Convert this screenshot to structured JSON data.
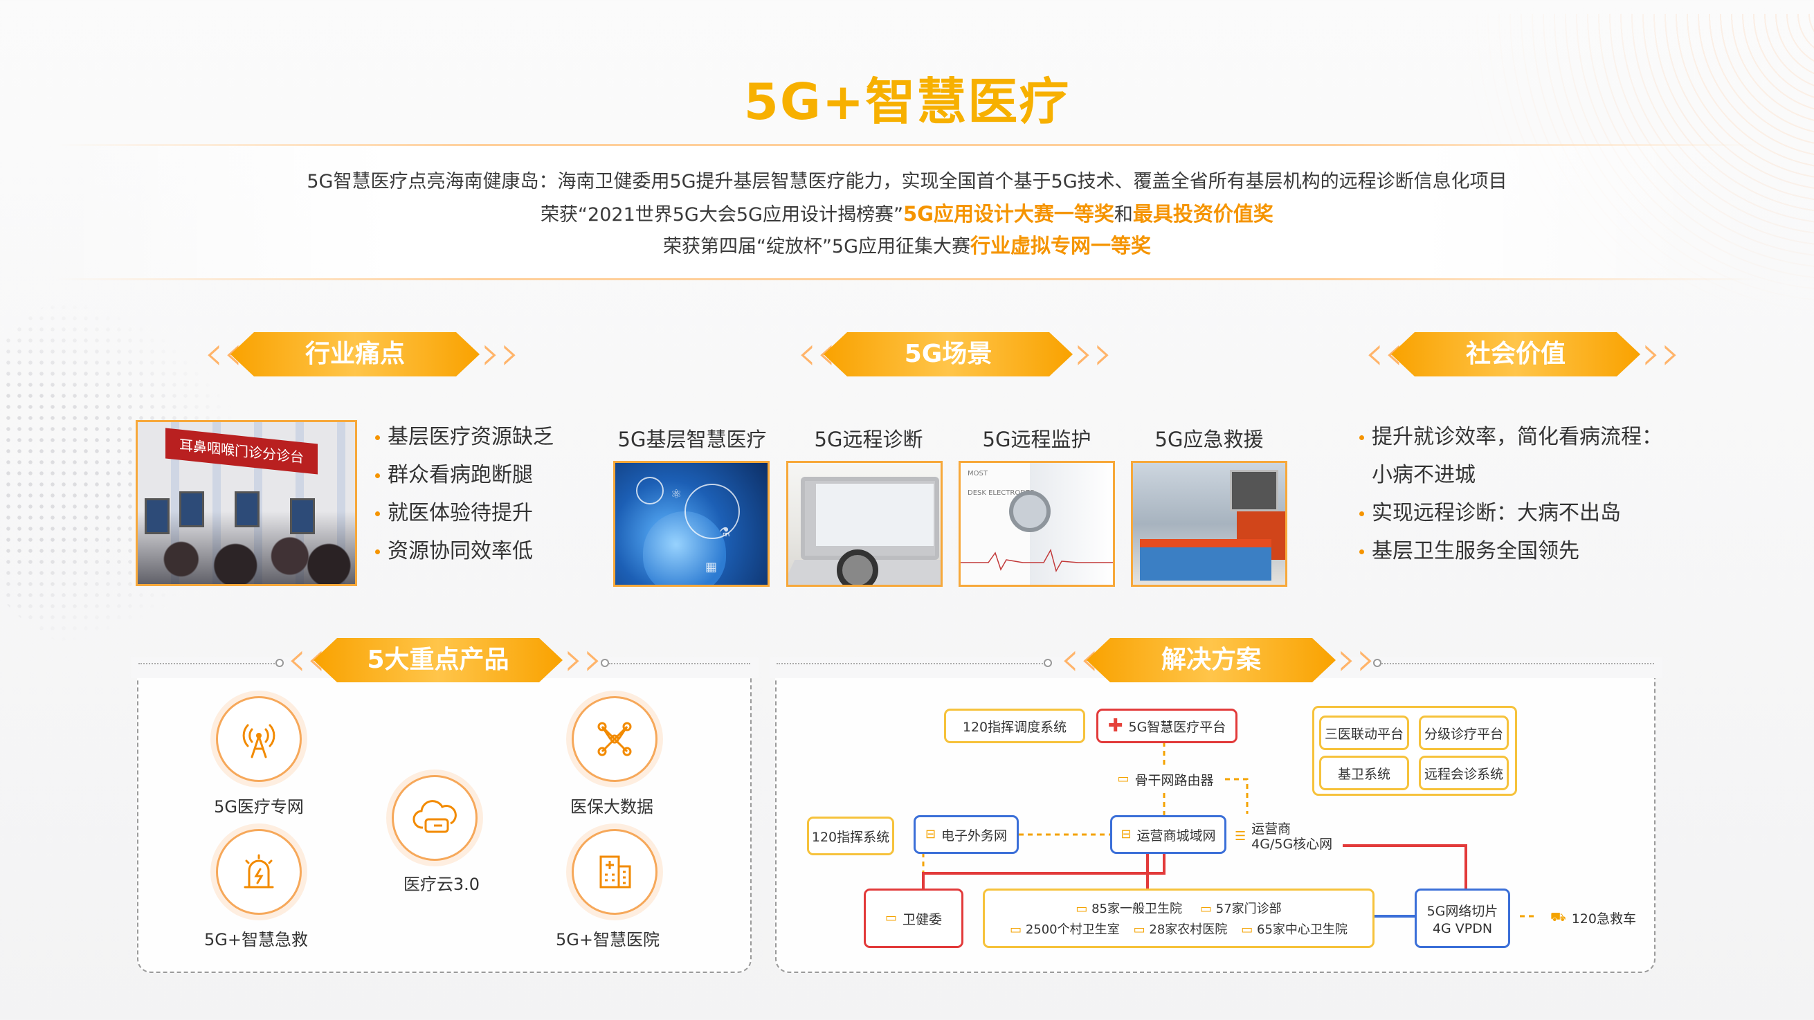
{
  "title": "5G+智慧医疗",
  "intro": {
    "line1": "5G智慧医疗点亮海南健康岛：海南卫健委用5G提升基层智慧医疗能力，实现全国首个基于5G技术、覆盖全省所有基层机构的远程诊断信息化项目",
    "line2_pre": "荣获“2021世界5G大会5G应用设计揭榜赛”",
    "line2_hl1": "5G应用设计大赛一等奖",
    "line2_mid": "和",
    "line2_hl2": "最具投资价值奖",
    "line3_pre": "荣获第四届“绽放杯”5G应用征集大赛",
    "line3_hl": "行业虚拟专网一等奖"
  },
  "sections": {
    "pain": "行业痛点",
    "scene": "5G场景",
    "value": "社会价值",
    "products": "5大重点产品",
    "solution": "解决方案"
  },
  "pain_points": [
    "基层医疗资源缺乏",
    "群众看病跑断腿",
    "就医体验待提升",
    "资源协同效率低"
  ],
  "scenes": [
    "5G基层智慧医疗",
    "5G远程诊断",
    "5G远程监护",
    "5G应急救援"
  ],
  "scene_photo_text": {
    "hall_sign": "耳鼻咽喉门诊分诊台",
    "monitor_lbl1": "MOST",
    "monitor_lbl2": "DESK ELECTRODES"
  },
  "social_values": {
    "v1_line1": "提升就诊效率，简化看病流程：",
    "v1_line2": "小病不进城",
    "v2": "实现远程诊断：大病不出岛",
    "v3": "基层卫生服务全国领先"
  },
  "products": [
    {
      "label": "5G医疗专网",
      "icon": "antenna-icon"
    },
    {
      "label": "医保大数据",
      "icon": "network-nodes-icon"
    },
    {
      "label": "医疗云3.0",
      "icon": "cloud-icon"
    },
    {
      "label": "5G+智慧急救",
      "icon": "emergency-light-icon"
    },
    {
      "label": "5G+智慧医院",
      "icon": "hospital-building-icon"
    }
  ],
  "solution": {
    "dispatch": "120指挥调度系统",
    "platform": "5G智慧医疗平台",
    "p_sanyi": "三医联动平台",
    "p_fenji": "分级诊疗平台",
    "p_jiwei": "基卫系统",
    "p_yuancheng": "远程会诊系统",
    "router": "骨干网路由器",
    "cmd": "120指挥系统",
    "extnet": "电子外务网",
    "metro": "运营商城域网",
    "core1": "运营商",
    "core2": "4G/5G核心网",
    "health": "卫健委",
    "h1": "85家一般卫生院",
    "h2": "57家门诊部",
    "h3": "2500个村卫生室",
    "h4": "28家农村医院",
    "h5": "65家中心卫生院",
    "slice1": "5G网络切片",
    "slice2": "4G VPDN",
    "ambulance": "120急救车"
  },
  "colors": {
    "accent": "#f7b000",
    "orange": "#f59400",
    "red": "#e23a3a",
    "blue": "#3b6fd8",
    "yellow": "#f6c23b"
  }
}
